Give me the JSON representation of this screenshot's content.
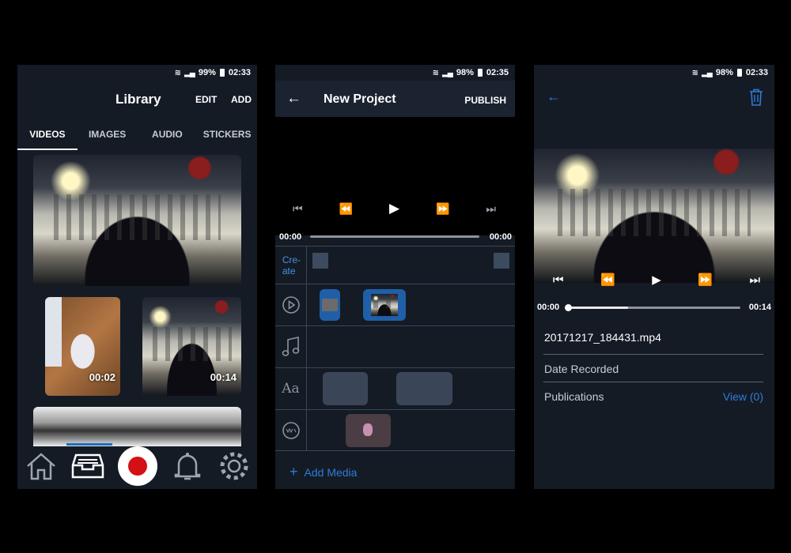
{
  "library": {
    "status": {
      "battery": "99%",
      "time": "02:33"
    },
    "title": "Library",
    "edit_label": "EDIT",
    "add_label": "ADD",
    "tabs": [
      {
        "label": "VIDEOS"
      },
      {
        "label": "IMAGES"
      },
      {
        "label": "AUDIO"
      },
      {
        "label": "STICKERS"
      }
    ],
    "videos": [
      {
        "duration": "00:02"
      },
      {
        "duration": "00:14"
      }
    ]
  },
  "project": {
    "status": {
      "battery": "98%",
      "time": "02:35"
    },
    "title": "New Project",
    "publish_label": "PUBLISH",
    "time_start": "00:00",
    "time_end": "00:00",
    "create_label": "Cre-\nate",
    "add_media_label": "Add Media"
  },
  "detail": {
    "status": {
      "battery": "98%",
      "time": "02:33"
    },
    "time_start": "00:00",
    "time_end": "00:14",
    "progress_fraction": 0.35,
    "filename": "20171217_184431.mp4",
    "date_recorded_label": "Date Recorded",
    "publications_label": "Publications",
    "view_label": "View (0)"
  },
  "colors": {
    "accent": "#2f7cd8",
    "record": "#d40f16",
    "panel": "#141b25"
  }
}
